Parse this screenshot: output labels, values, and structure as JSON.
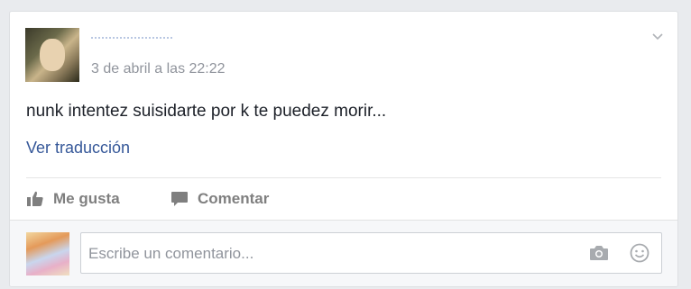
{
  "post": {
    "timestamp": "3 de abril a las 22:22",
    "text": "nunk intentez suisidarte por k te puedez morir...",
    "translate_label": "Ver traducción"
  },
  "actions": {
    "like_label": "Me gusta",
    "comment_label": "Comentar"
  },
  "comment_box": {
    "placeholder": "Escribe un comentario..."
  },
  "colors": {
    "link": "#365899",
    "text": "#1d2129",
    "muted": "#90949c",
    "background": "#e9ebee"
  }
}
